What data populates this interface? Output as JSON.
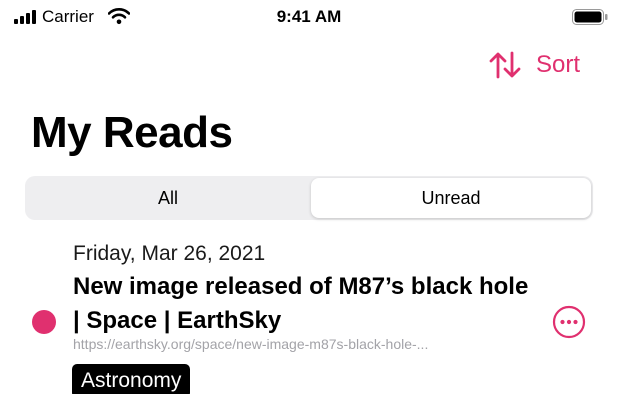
{
  "status_bar": {
    "carrier": "Carrier",
    "time": "9:41 AM",
    "icons": [
      "signal-icon",
      "wifi-icon",
      "battery-icon"
    ]
  },
  "nav": {
    "sort_label": "Sort",
    "sort_icon": "arrow-up-down-icon"
  },
  "page_title": "My Reads",
  "segments": {
    "items": [
      "All",
      "Unread"
    ],
    "selected": "Unread"
  },
  "reads": [
    {
      "date": "Friday, Mar 26, 2021",
      "title": "New image released of M87’s black hole | Space | EarthSky",
      "url": "https://earthsky.org/space/new-image-m87s-black-hole-released",
      "url_display": "https://earthsky.org/space/new-image-m87s-black-hole-...",
      "unread": true,
      "tag": "Astronomy",
      "more_icon": "ellipsis-circle-icon"
    }
  ],
  "colors": {
    "accent": "#e0306f",
    "segment_bg": "#eeeef0",
    "url_text": "#a3a3a8"
  }
}
